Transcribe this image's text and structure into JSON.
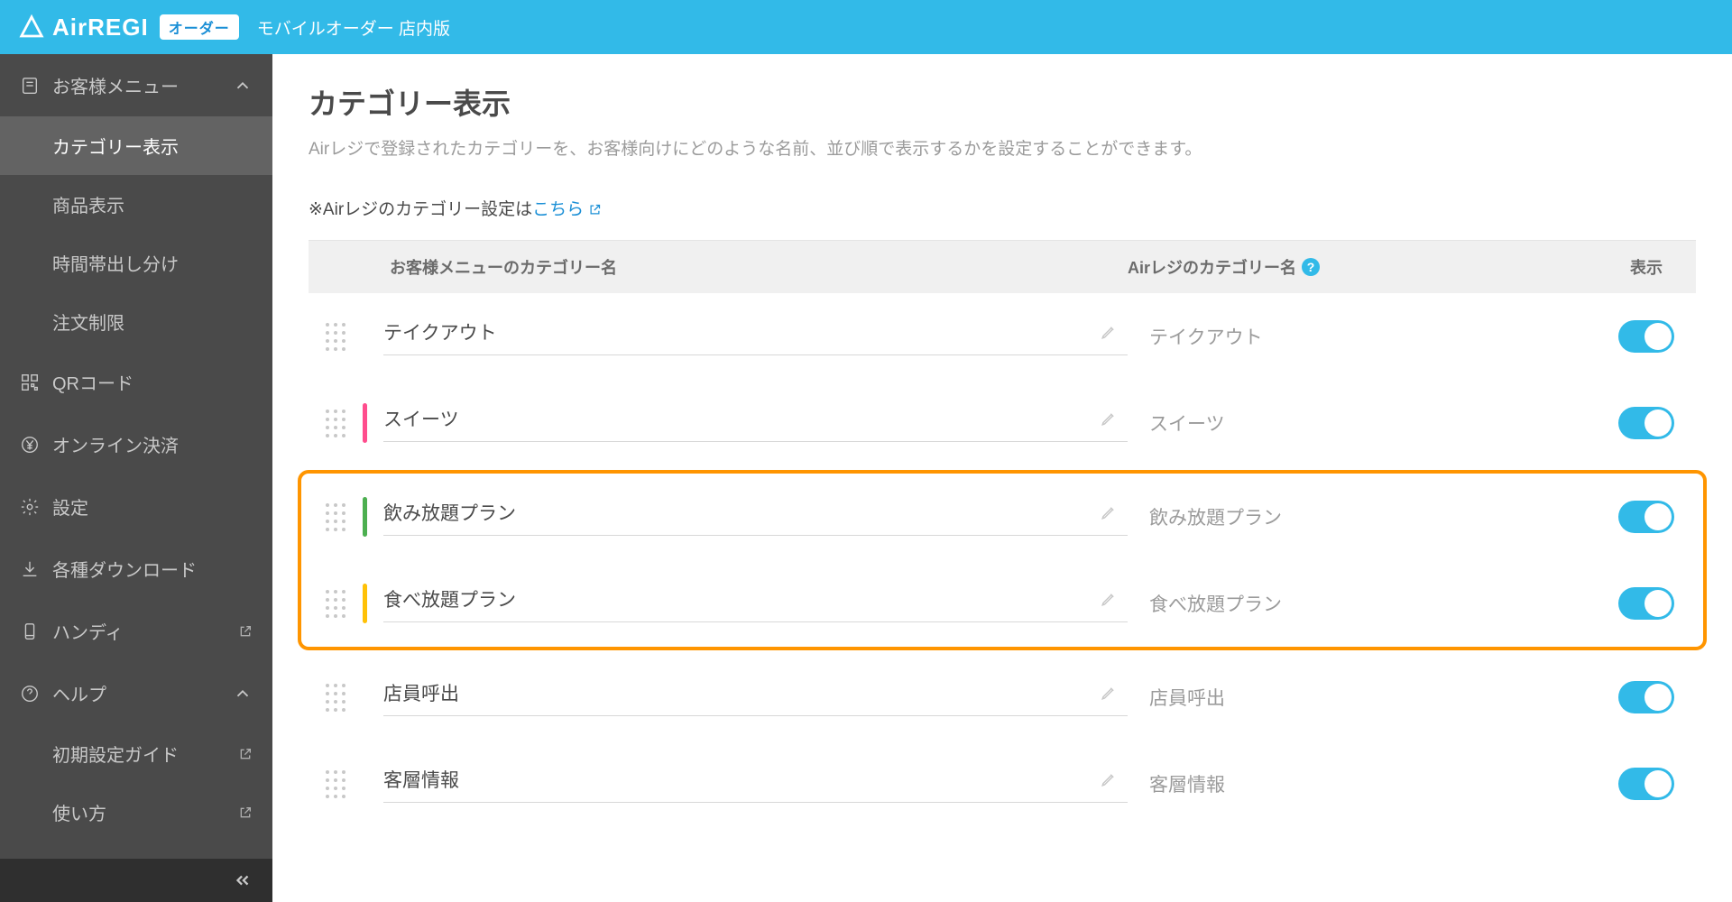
{
  "header": {
    "brand": "AirREGI",
    "badge": "オーダー",
    "subtitle": "モバイルオーダー 店内版"
  },
  "sidebar": {
    "section1": {
      "label": "お客様メニュー"
    },
    "sub": {
      "category": "カテゴリー表示",
      "product": "商品表示",
      "timeband": "時間帯出し分け",
      "orderlimit": "注文制限"
    },
    "qrcode": "QRコード",
    "onlinepay": "オンライン決済",
    "settings": "設定",
    "downloads": "各種ダウンロード",
    "handy": "ハンディ",
    "help": "ヘルプ",
    "helpsub": {
      "guide": "初期設定ガイド",
      "howto": "使い方"
    }
  },
  "main": {
    "title": "カテゴリー表示",
    "desc": "Airレジで登録されたカテゴリーを、お客様向けにどのような名前、並び順で表示するかを設定することができます。",
    "note_prefix": "※Airレジのカテゴリー設定は",
    "note_link": "こちら",
    "columns": {
      "name": "お客様メニューのカテゴリー名",
      "airname": "Airレジのカテゴリー名",
      "display": "表示"
    }
  },
  "rows": [
    {
      "name": "テイクアウト",
      "airname": "テイクアウト",
      "color": "transparent",
      "on": true,
      "hl": false
    },
    {
      "name": "スイーツ",
      "airname": "スイーツ",
      "color": "#FF4D8D",
      "on": true,
      "hl": false
    },
    {
      "name": "飲み放題プラン",
      "airname": "飲み放題プラン",
      "color": "#4CAF50",
      "on": true,
      "hl": true
    },
    {
      "name": "食べ放題プラン",
      "airname": "食べ放題プラン",
      "color": "#FFC107",
      "on": true,
      "hl": true
    },
    {
      "name": "店員呼出",
      "airname": "店員呼出",
      "color": "transparent",
      "on": true,
      "hl": false
    },
    {
      "name": "客層情報",
      "airname": "客層情報",
      "color": "transparent",
      "on": true,
      "hl": false
    }
  ]
}
